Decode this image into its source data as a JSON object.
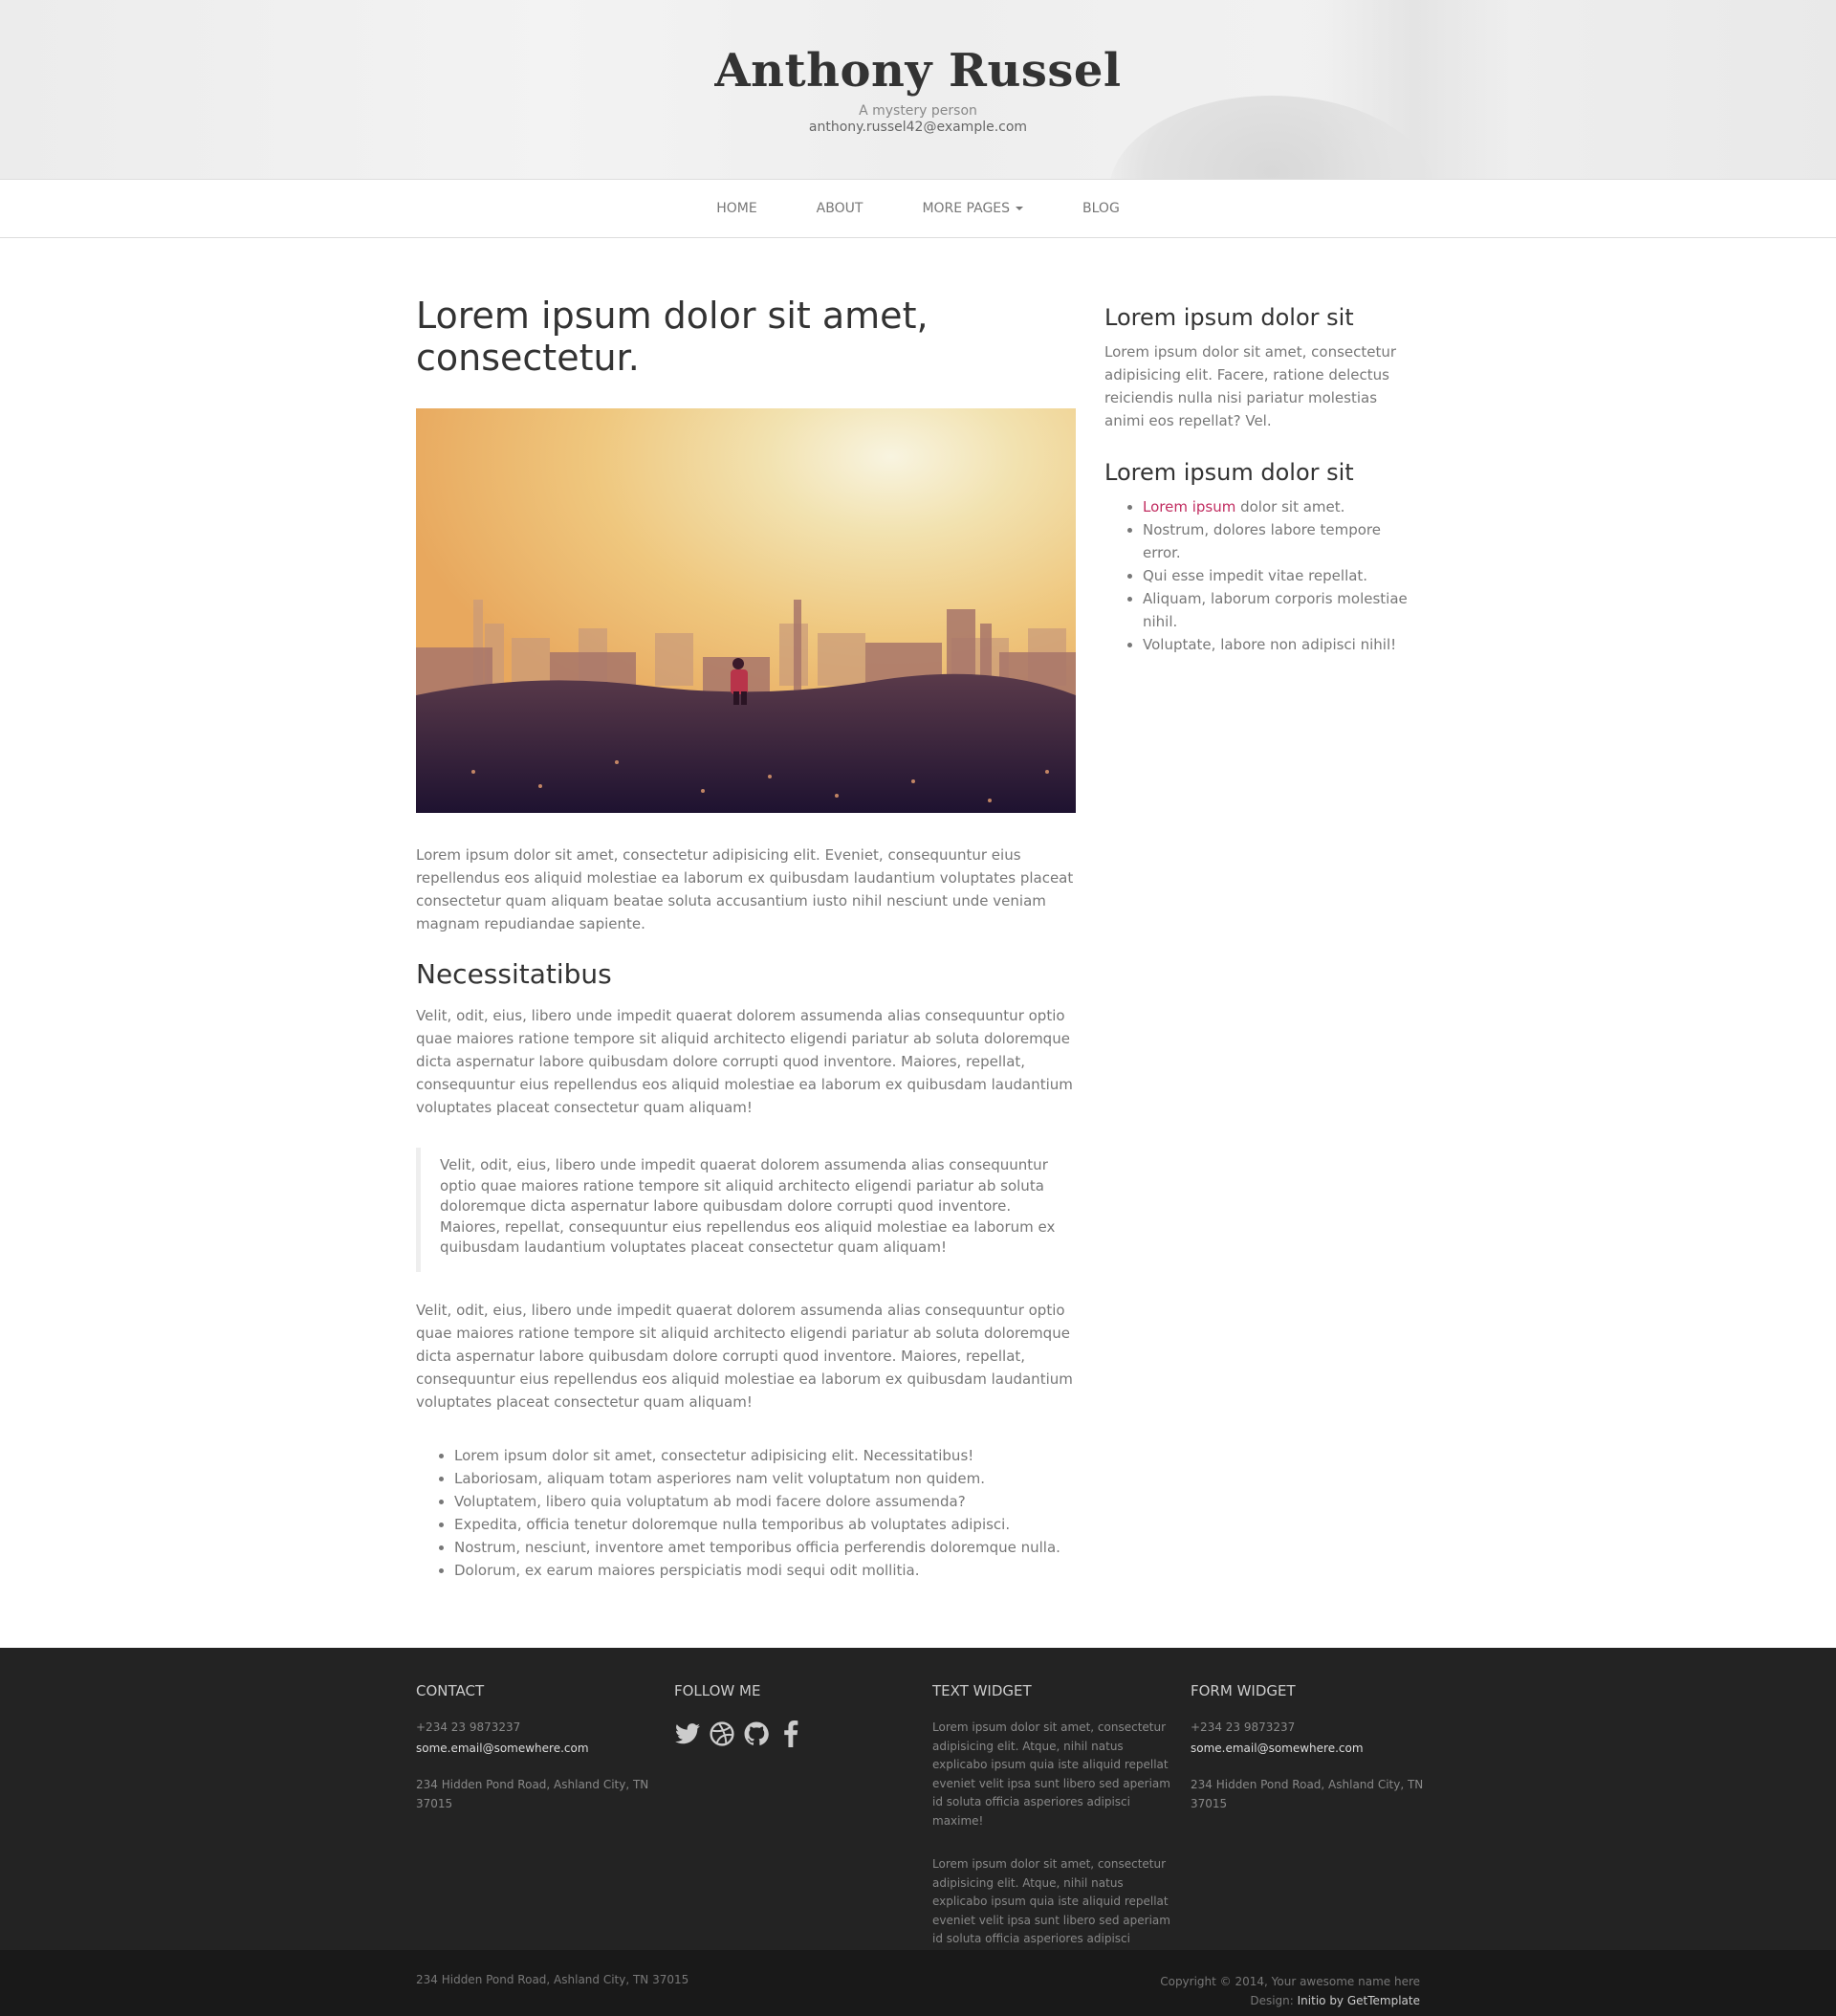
{
  "header": {
    "title": "Anthony Russel",
    "tagline": "A mystery person",
    "email": "anthony.russel42@example.com"
  },
  "nav": {
    "items": [
      {
        "label": "HOME"
      },
      {
        "label": "ABOUT"
      },
      {
        "label": "MORE PAGES"
      },
      {
        "label": "BLOG"
      }
    ]
  },
  "article": {
    "title": "Lorem ipsum dolor sit amet, consectetur.",
    "p1": "Lorem ipsum dolor sit amet, consectetur adipisicing elit. Eveniet, consequuntur eius repellendus eos aliquid molestiae ea laborum ex quibusdam laudantium voluptates placeat consectetur quam aliquam beatae soluta accusantium iusto nihil nesciunt unde veniam magnam repudiandae sapiente.",
    "section_title": "Necessitatibus",
    "p2": "Velit, odit, eius, libero unde impedit quaerat dolorem assumenda alias consequuntur optio quae maiores ratione tempore sit aliquid architecto eligendi pariatur ab soluta doloremque dicta aspernatur labore quibusdam dolore corrupti quod inventore. Maiores, repellat, consequuntur eius repellendus eos aliquid molestiae ea laborum ex quibusdam laudantium voluptates placeat consectetur quam aliquam!",
    "quote": "Velit, odit, eius, libero unde impedit quaerat dolorem assumenda alias consequuntur optio quae maiores ratione tempore sit aliquid architecto eligendi pariatur ab soluta doloremque dicta aspernatur labore quibusdam dolore corrupti quod inventore. Maiores, repellat, consequuntur eius repellendus eos aliquid molestiae ea laborum ex quibusdam laudantium voluptates placeat consectetur quam aliquam!",
    "p3": "Velit, odit, eius, libero unde impedit quaerat dolorem assumenda alias consequuntur optio quae maiores ratione tempore sit aliquid architecto eligendi pariatur ab soluta doloremque dicta aspernatur labore quibusdam dolore corrupti quod inventore. Maiores, repellat, consequuntur eius repellendus eos aliquid molestiae ea laborum ex quibusdam laudantium voluptates placeat consectetur quam aliquam!",
    "bullets": [
      "Lorem ipsum dolor sit amet, consectetur adipisicing elit. Necessitatibus!",
      "Laboriosam, aliquam totam asperiores nam velit voluptatum non quidem.",
      "Voluptatem, libero quia voluptatum ab modi facere dolore assumenda?",
      "Expedita, officia tenetur doloremque nulla temporibus ab voluptates adipisci.",
      "Nostrum, nesciunt, inventore amet temporibus officia perferendis doloremque nulla.",
      "Dolorum, ex earum maiores perspiciatis modi sequi odit mollitia."
    ]
  },
  "sidebar": {
    "widget1_title": "Lorem ipsum dolor sit",
    "widget1_text": "Lorem ipsum dolor sit amet, consectetur adipisicing elit. Facere, ratione delectus reiciendis nulla nisi pariatur molestias animi eos repellat? Vel.",
    "widget2_title": "Lorem ipsum dolor sit",
    "list_link": "Lorem ipsum",
    "list_first_rest": " dolor sit amet.",
    "list": [
      "Nostrum, dolores labore tempore error.",
      "Qui esse impedit vitae repellat.",
      "Aliquam, laborum corporis molestiae nihil.",
      "Voluptate, labore non adipisci nihil!"
    ]
  },
  "footer": {
    "contact": {
      "heading": "CONTACT",
      "phone": "+234 23 9873237",
      "email": "some.email@somewhere.com",
      "address": "234 Hidden Pond Road, Ashland City, TN 37015"
    },
    "follow": {
      "heading": "FOLLOW ME",
      "icons": [
        "twitter-icon",
        "dribbble-icon",
        "github-icon",
        "facebook-icon"
      ]
    },
    "text_widget": {
      "heading": "TEXT WIDGET",
      "para1": "Lorem ipsum dolor sit amet, consectetur adipisicing elit. Atque, nihil natus explicabo ipsum quia iste aliquid repellat eveniet velit ipsa sunt libero sed aperiam id soluta officia asperiores adipisci maxime!",
      "para2": "Lorem ipsum dolor sit amet, consectetur adipisicing elit. Atque, nihil natus explicabo ipsum quia iste aliquid repellat eveniet velit ipsa sunt libero sed aperiam id soluta officia asperiores adipisci maxime!"
    },
    "form_widget": {
      "heading": "FORM WIDGET",
      "phone": "+234 23 9873237",
      "email": "some.email@somewhere.com",
      "address": "234 Hidden Pond Road, Ashland City, TN 37015"
    },
    "bottom": {
      "address": "234 Hidden Pond Road, Ashland City, TN 37015",
      "copyright": "Copyright © 2014, Your awesome name here",
      "design_label": "Design: ",
      "design_link": "Initio by GetTemplate"
    }
  },
  "colors": {
    "accent": "#c12c60",
    "footer_bg": "#232323",
    "footer_bottom_bg": "#191919"
  }
}
